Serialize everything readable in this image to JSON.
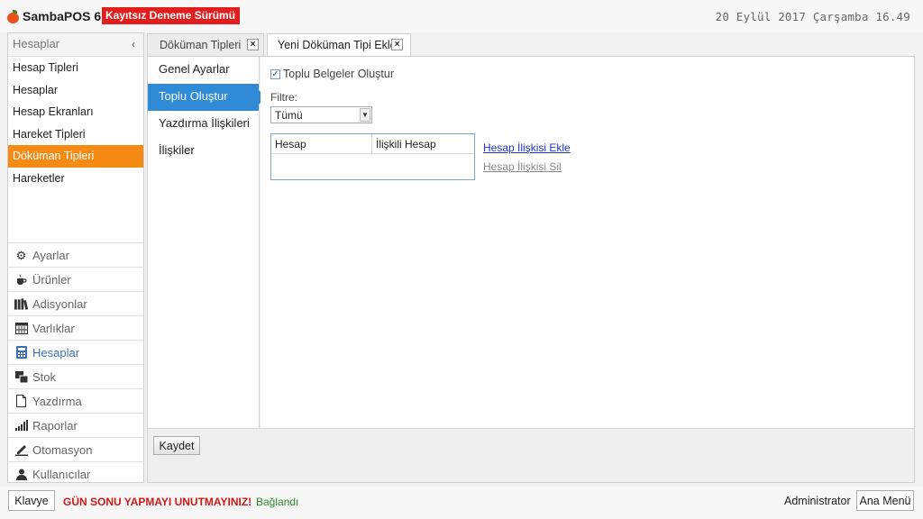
{
  "app": {
    "name": "SambaPOS 6",
    "trial_badge": "Kayıtsız Deneme Sürümü",
    "datetime": "20 Eylül 2017 Çarşamba 16.49",
    "brand_color": "#e8501c",
    "badge_color": "#e11d1d"
  },
  "sidebar": {
    "title": "Hesaplar",
    "collapse_icon": "chevron-left-icon",
    "items": [
      {
        "label": "Hesap Tipleri"
      },
      {
        "label": "Hesaplar"
      },
      {
        "label": "Hesap Ekranları"
      },
      {
        "label": "Hareket Tipleri"
      },
      {
        "label": "Döküman Tipleri",
        "active": true
      },
      {
        "label": "Hareketler"
      }
    ],
    "active_color": "#f58b14"
  },
  "modules": [
    {
      "label": "Ayarlar",
      "icon": "gear-icon"
    },
    {
      "label": "Ürünler",
      "icon": "coffee-cup-icon"
    },
    {
      "label": "Adisyonlar",
      "icon": "books-icon"
    },
    {
      "label": "Varlıklar",
      "icon": "table-icon"
    },
    {
      "label": "Hesaplar",
      "icon": "calculator-icon",
      "active": true
    },
    {
      "label": "Stok",
      "icon": "stack-icon"
    },
    {
      "label": "Yazdırma",
      "icon": "document-icon"
    },
    {
      "label": "Raporlar",
      "icon": "bar-signal-icon"
    },
    {
      "label": "Otomasyon",
      "icon": "pen-icon"
    },
    {
      "label": "Kullanıcılar",
      "icon": "user-icon"
    }
  ],
  "tabs": [
    {
      "label": "Döküman Tipleri",
      "close": "×"
    },
    {
      "label": "Yeni Döküman Tipi Ekle",
      "close": "×",
      "active": true
    }
  ],
  "settings_menu": [
    {
      "label": "Genel Ayarlar"
    },
    {
      "label": "Toplu Oluştur",
      "active": true
    },
    {
      "label": "Yazdırma İlişkileri"
    },
    {
      "label": "İlişkiler"
    }
  ],
  "form": {
    "checkbox_label": "Toplu Belgeler Oluştur",
    "checkbox_checked": true,
    "checkmark": "✓",
    "filter_label": "Filtre:",
    "filter_value": "Tümü",
    "grid_headers": [
      "Hesap",
      "İlişkili Hesap"
    ],
    "add_link": "Hesap İlişkisi Ekle",
    "delete_link": "Hesap İlişkisi Sil"
  },
  "save_button": "Kaydet",
  "statusbar": {
    "keyboard_button": "Klavye",
    "warning": "GÜN SONU YAPMAYI UNUTMAYINIZ!",
    "connection": "Bağlandı",
    "user": "Administrator",
    "main_menu_button": "Ana Menü"
  }
}
